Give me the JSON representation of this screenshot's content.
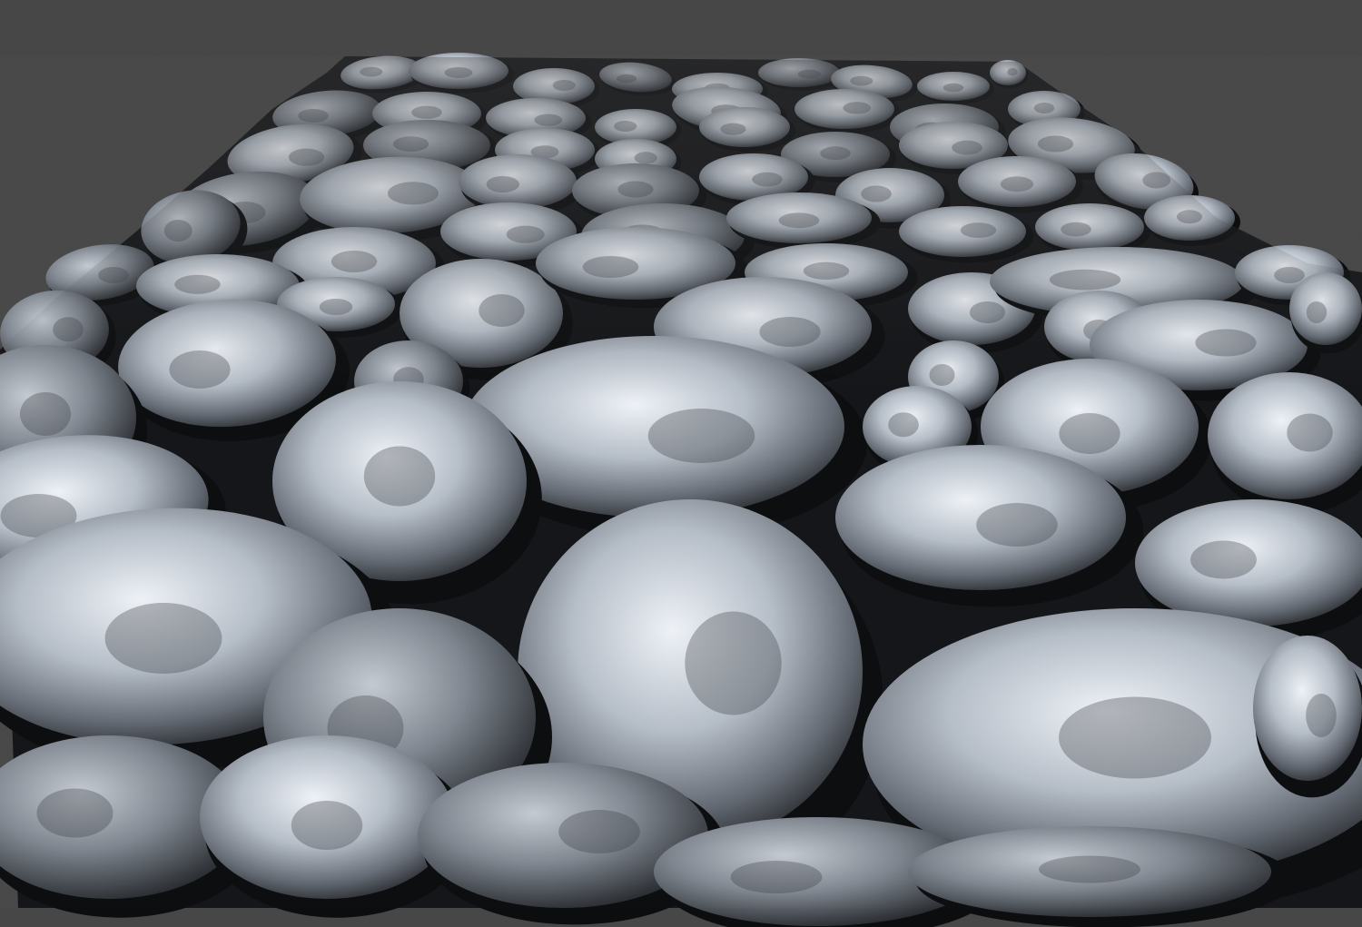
{
  "viewport": {
    "background_color": "#474747"
  },
  "scene": {
    "subject": "stone-cobblestone-terrain-mesh",
    "palette": {
      "stone_light": "#e8edf3",
      "stone_mid": "#a9b0ba",
      "stone_dark": "#5d636c",
      "shadow": "#17191c",
      "gap": "#0e0f11"
    }
  }
}
